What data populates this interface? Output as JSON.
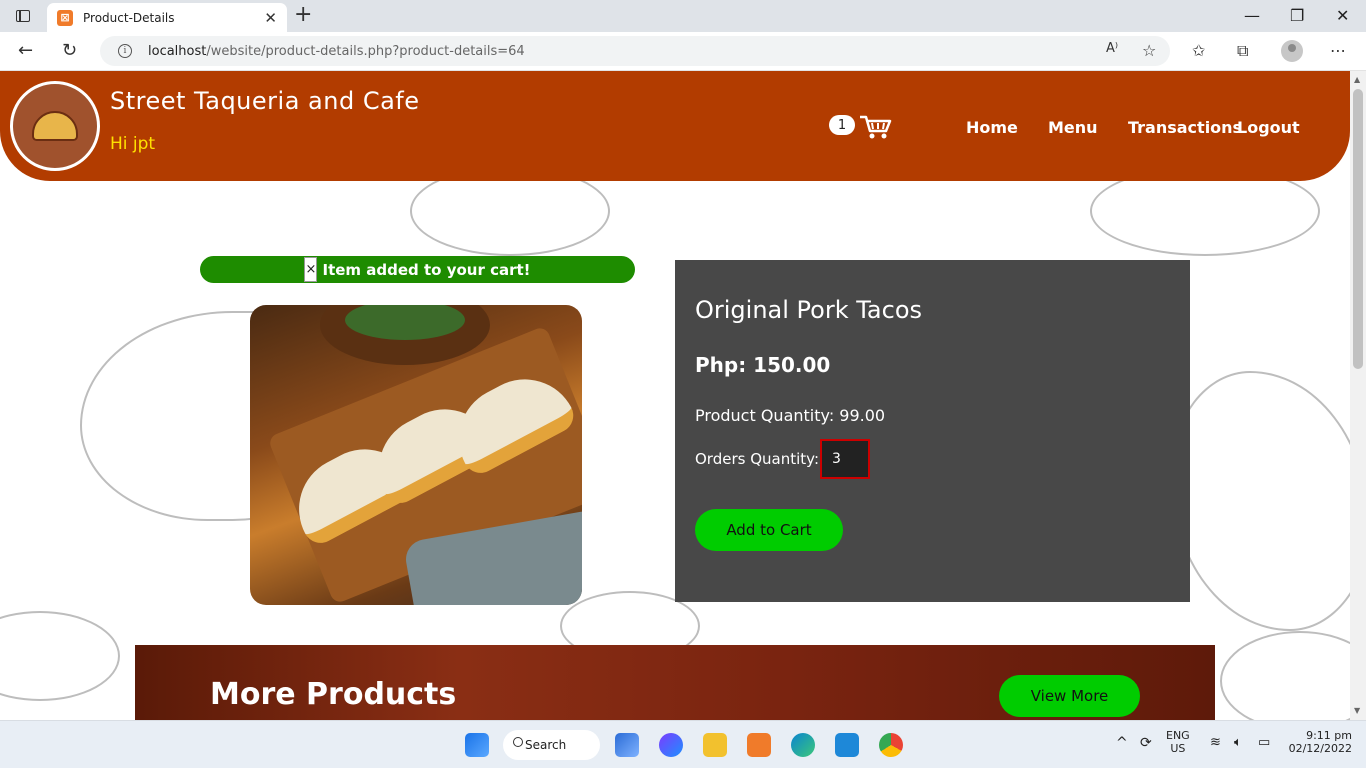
{
  "browser": {
    "tab_title": "Product-Details",
    "tab_favicon": "xampp-icon",
    "url_host": "localhost",
    "url_path": "/website/product-details.php?product-details=64"
  },
  "header": {
    "brand": "Street Taqueria and Cafe",
    "greeting": "Hi jpt",
    "cart_count": "1",
    "nav": [
      "Home",
      "Menu",
      "Transactions",
      "Logout"
    ],
    "bg_color": "#b23c00"
  },
  "alert": {
    "close": "×",
    "message": "Item added to your cart!"
  },
  "product": {
    "name": "Original Pork Tacos",
    "price": "Php: 150.00",
    "quantity": "Product Quantity: 99.00",
    "orders_label": "Orders Quantity:",
    "orders_value": "3",
    "add_button": "Add to Cart"
  },
  "more": {
    "title": "More Products",
    "button": "View More"
  },
  "taskbar": {
    "search": "Search",
    "lang_top": "ENG",
    "lang_bottom": "US",
    "time": "9:11 pm",
    "date": "02/12/2022"
  }
}
